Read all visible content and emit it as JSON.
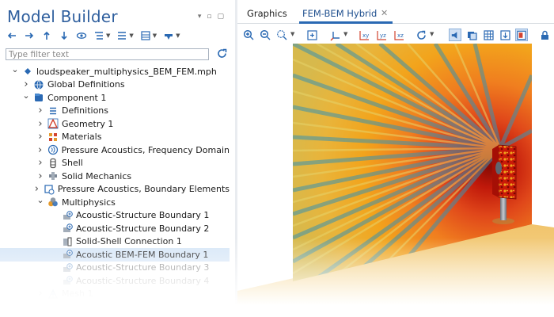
{
  "panel": {
    "title": "Model Builder",
    "filter_placeholder": "Type filter text"
  },
  "tree": [
    {
      "label": "loudspeaker_multiphysics_BEM_FEM.mph",
      "level": 0,
      "expanded": true,
      "icon": "model-file-icon"
    },
    {
      "label": "Global Definitions",
      "level": 1,
      "expanded": false,
      "icon": "globe-icon"
    },
    {
      "label": "Component 1",
      "level": 1,
      "expanded": true,
      "icon": "component-icon"
    },
    {
      "label": "Definitions",
      "level": 2,
      "expanded": false,
      "icon": "definitions-icon"
    },
    {
      "label": "Geometry 1",
      "level": 2,
      "expanded": false,
      "icon": "geometry-icon"
    },
    {
      "label": "Materials",
      "level": 2,
      "expanded": false,
      "icon": "materials-icon"
    },
    {
      "label": "Pressure Acoustics, Frequency Domain",
      "level": 2,
      "expanded": false,
      "icon": "pressure-acoustics-icon"
    },
    {
      "label": "Shell",
      "level": 2,
      "expanded": false,
      "icon": "shell-icon"
    },
    {
      "label": "Solid Mechanics",
      "level": 2,
      "expanded": false,
      "icon": "solid-mechanics-icon"
    },
    {
      "label": "Pressure Acoustics, Boundary Elements",
      "level": 2,
      "expanded": false,
      "icon": "boundary-elements-icon"
    },
    {
      "label": "Multiphysics",
      "level": 2,
      "expanded": true,
      "icon": "multiphysics-icon"
    },
    {
      "label": "Acoustic-Structure Boundary 1",
      "level": 3,
      "icon": "coupling-icon"
    },
    {
      "label": "Acoustic-Structure Boundary 2",
      "level": 3,
      "icon": "coupling-icon"
    },
    {
      "label": "Solid-Shell Connection 1",
      "level": 3,
      "icon": "solid-shell-icon"
    },
    {
      "label": "Acoustic BEM-FEM Boundary 1",
      "level": 3,
      "icon": "coupling-icon",
      "selected": true
    },
    {
      "label": "Acoustic-Structure Boundary 3",
      "level": 3,
      "icon": "coupling-icon"
    },
    {
      "label": "Acoustic-Structure Boundary 4",
      "level": 3,
      "icon": "coupling-icon"
    },
    {
      "label": "Mesh 1",
      "level": 2,
      "expanded": false,
      "icon": "mesh-icon"
    }
  ],
  "tabs": {
    "graphics": "Graphics",
    "active": "FEM-BEM Hybrid"
  },
  "toolbar_icons": [
    "zoom-in-icon",
    "zoom-out-icon",
    "zoom-box-icon",
    "zoom-extents-icon",
    "axis-icon",
    "xy-view-icon",
    "yz-view-icon",
    "xz-view-icon",
    "rotate-icon",
    "scene-light-icon",
    "transparency-icon",
    "wireframe-icon",
    "reset-view-icon",
    "render-icon",
    "lock-icon"
  ],
  "colors": {
    "accent": "#2a69b3",
    "title": "#2f5f9e",
    "selection": "#d6e6f7",
    "field_hot": "#c0180a",
    "field_warm": "#f2a41c",
    "field_cool": "#4aa3b8",
    "floor": "#f3cf85"
  }
}
